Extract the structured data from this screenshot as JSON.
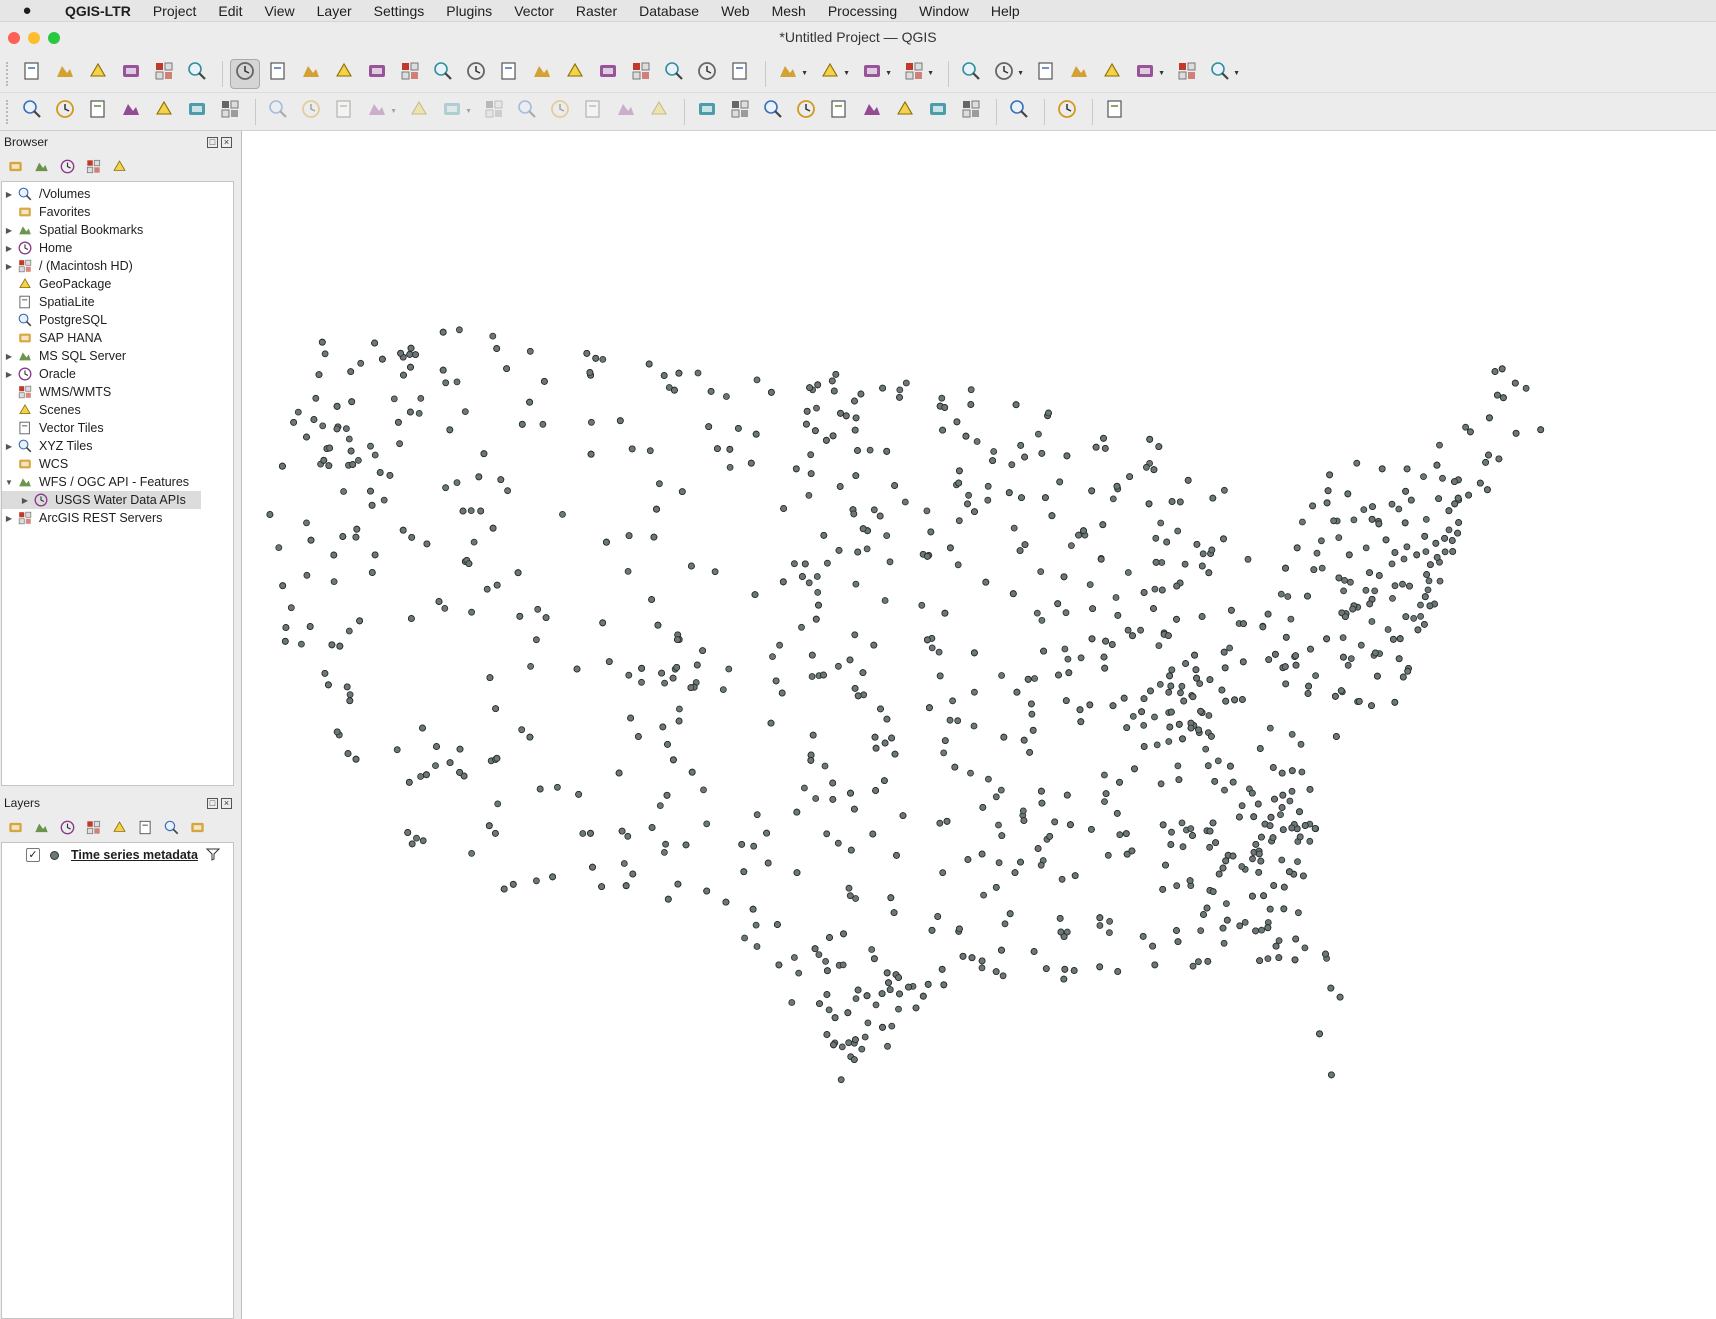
{
  "menubar": {
    "apple_icon": "apple-logo-icon",
    "app_name": "QGIS-LTR",
    "items": [
      "Project",
      "Edit",
      "View",
      "Layer",
      "Settings",
      "Plugins",
      "Vector",
      "Raster",
      "Database",
      "Web",
      "Mesh",
      "Processing",
      "Window",
      "Help"
    ]
  },
  "window": {
    "title": "*Untitled Project — QGIS",
    "traffic_lights": {
      "close": "#fe5f57",
      "minimize": "#febc2e",
      "zoom": "#28c840"
    }
  },
  "toolbar1": {
    "buttons": [
      "new-project",
      "open-project",
      "save-project",
      "save-as",
      "print-layout",
      "style-manager",
      "pan-map",
      "pan-to-selection",
      "zoom-in",
      "zoom-out",
      "zoom-full",
      "zoom-to-selection",
      "zoom-to-layer",
      "zoom-native",
      "zoom-last",
      "zoom-next",
      "new-map-view",
      "new-3d-map-view",
      "new-bookmark",
      "show-bookmarks",
      "temporal-controller",
      "refresh",
      "select-features",
      "select-by-value",
      "deselect-all",
      "select-by-location",
      "identify",
      "attribute-table",
      "processing-toolbox",
      "statistics",
      "open-field-calculator",
      "measure-line",
      "map-tips",
      "more-tools"
    ]
  },
  "toolbar2": {
    "buttons": [
      "data-source-manager",
      "new-geopackage-layer",
      "new-shapefile-layer",
      "new-spatialite-layer",
      "new-temporary-layer",
      "new-virtual-layer",
      "create-layer",
      "toggle-editing",
      "current-edits",
      "save-edits",
      "digitize",
      "vertex-tool",
      "modify-attributes",
      "delete-selected",
      "cut-features",
      "copy-features",
      "paste-features",
      "undo",
      "redo",
      "label-tool",
      "diagram-tool",
      "pin-labels",
      "show-hide-labels",
      "move-label",
      "rotate-label",
      "change-label",
      "highlight-pinned",
      "label-settings",
      "metasearch",
      "python-console",
      "help-contents"
    ]
  },
  "browser": {
    "title": "Browser",
    "tools": [
      "add-layer",
      "refresh",
      "filter",
      "collapse-all",
      "properties"
    ],
    "items": [
      {
        "label": "/Volumes",
        "icon": "folder-icon",
        "expandable": true
      },
      {
        "label": "Favorites",
        "icon": "star-icon",
        "expandable": false
      },
      {
        "label": "Spatial Bookmarks",
        "icon": "bookmark-icon",
        "expandable": true
      },
      {
        "label": "Home",
        "icon": "home-folder-icon",
        "expandable": true
      },
      {
        "label": "/ (Macintosh HD)",
        "icon": "folder-icon",
        "expandable": true
      },
      {
        "label": "GeoPackage",
        "icon": "geopackage-icon",
        "expandable": false
      },
      {
        "label": "SpatiaLite",
        "icon": "spatialite-icon",
        "expandable": false
      },
      {
        "label": "PostgreSQL",
        "icon": "postgresql-icon",
        "expandable": false
      },
      {
        "label": "SAP HANA",
        "icon": "sap-hana-icon",
        "expandable": false
      },
      {
        "label": "MS SQL Server",
        "icon": "mssql-icon",
        "expandable": true
      },
      {
        "label": "Oracle",
        "icon": "oracle-icon",
        "expandable": true
      },
      {
        "label": "WMS/WMTS",
        "icon": "wms-globe-icon",
        "expandable": false
      },
      {
        "label": "Scenes",
        "icon": "scenes-icon",
        "expandable": false
      },
      {
        "label": "Vector Tiles",
        "icon": "vector-tiles-icon",
        "expandable": false
      },
      {
        "label": "XYZ Tiles",
        "icon": "xyz-tiles-icon",
        "expandable": true
      },
      {
        "label": "WCS",
        "icon": "wcs-globe-icon",
        "expandable": false
      },
      {
        "label": "WFS / OGC API - Features",
        "icon": "wfs-globe-icon",
        "expandable": true,
        "expanded": true
      },
      {
        "label": "USGS Water Data APIs",
        "icon": "wfs-connection-icon",
        "expandable": true,
        "child": true,
        "selected": true
      },
      {
        "label": "ArcGIS REST Servers",
        "icon": "arcgis-globe-icon",
        "expandable": true
      }
    ]
  },
  "layers_panel": {
    "title": "Layers",
    "tools": [
      "style-layer",
      "add-group",
      "manage-visibility",
      "filter-legend",
      "filter-by-expression",
      "expand-all",
      "collapse-all",
      "remove-layer"
    ],
    "layers": [
      {
        "name": "Time series metadata",
        "visible": true,
        "checkmark": "✓",
        "symbol_color": "#6b7879"
      }
    ]
  },
  "map": {
    "background": "#ffffff",
    "point_fill": "#6b7879",
    "point_stroke": "#2a2a2a"
  }
}
